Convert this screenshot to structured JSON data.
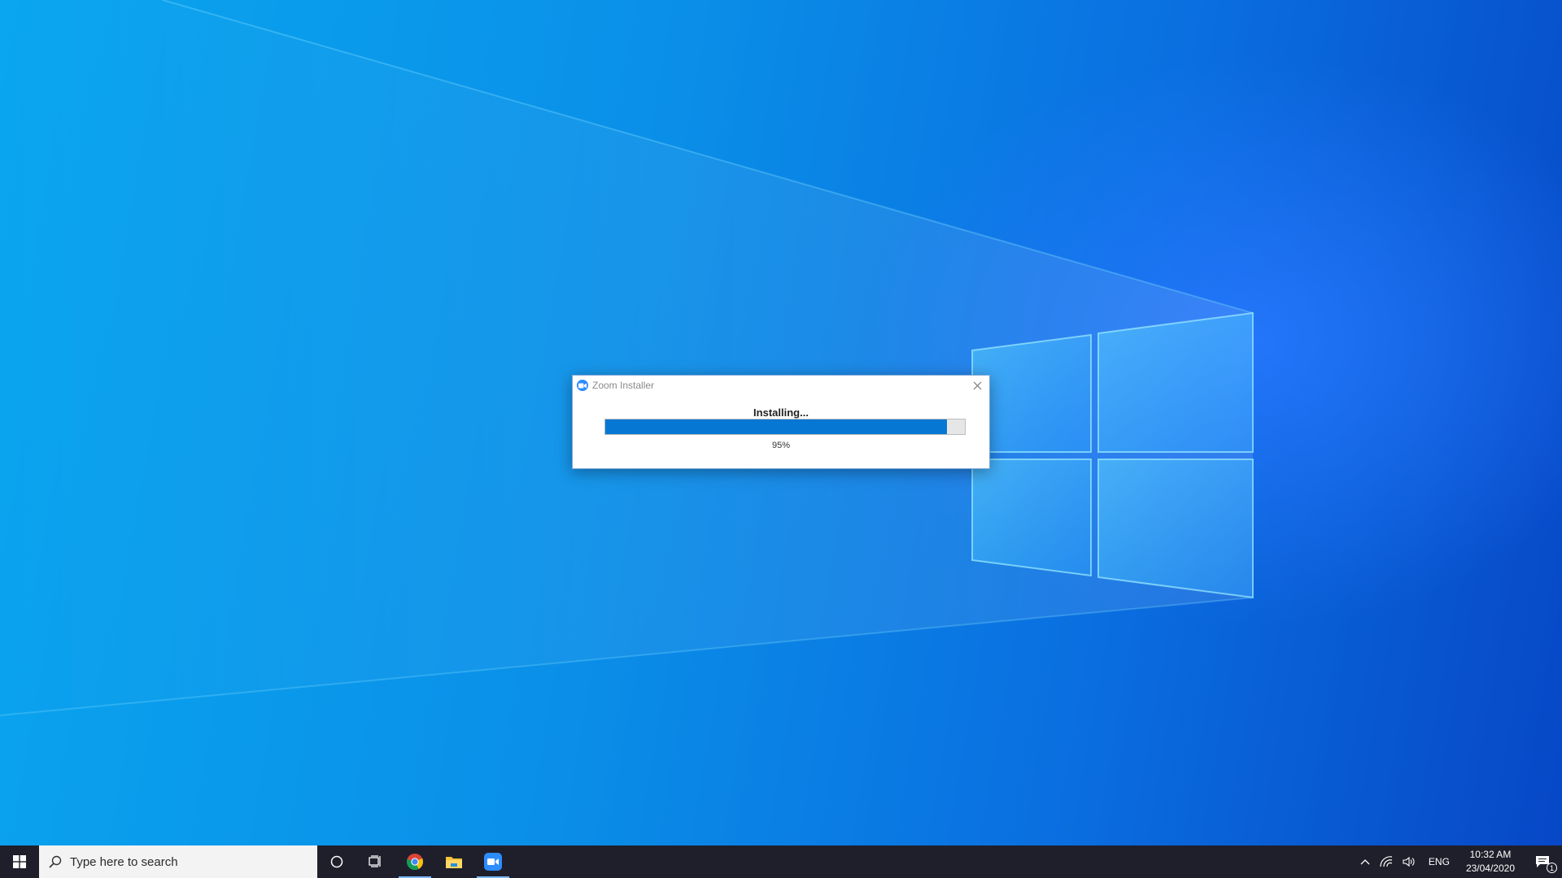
{
  "dialog": {
    "title": "Zoom Installer",
    "status": "Installing...",
    "progress_fraction": 0.95,
    "percent_label": "95%",
    "icon": "zoom-icon"
  },
  "taskbar": {
    "search_placeholder": "Type here to search",
    "pinned": [
      {
        "name": "cortana",
        "icon": "circle-icon"
      },
      {
        "name": "task-view",
        "icon": "task-view-icon"
      },
      {
        "name": "chrome",
        "icon": "chrome-icon",
        "active": true
      },
      {
        "name": "file-explorer",
        "icon": "folder-icon"
      },
      {
        "name": "zoom",
        "icon": "zoom-icon",
        "active": true
      }
    ],
    "tray": {
      "language": "ENG",
      "time": "10:32 AM",
      "date": "23/04/2020",
      "notification_count": "1"
    }
  },
  "colors": {
    "progress_fill": "#0678d4",
    "taskbar_bg": "#1f1f2b",
    "zoom_blue": "#2d8cff"
  }
}
